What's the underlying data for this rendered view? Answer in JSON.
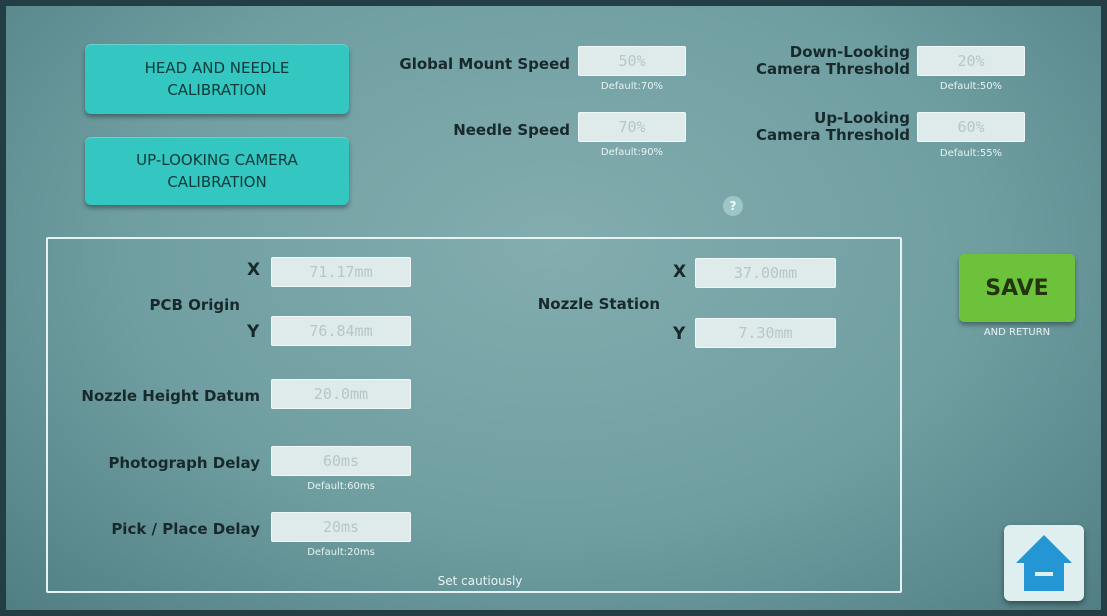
{
  "buttons": {
    "head_needle": "HEAD AND NEEDLE\nCALIBRATION",
    "uplooking_cal": "UP-LOOKING CAMERA\nCALIBRATION",
    "save": "SAVE",
    "save_sub": "AND RETURN",
    "help": "?"
  },
  "top_settings": {
    "global_mount_speed": {
      "label": "Global Mount Speed",
      "value": "50%",
      "default": "Default:70%"
    },
    "needle_speed": {
      "label": "Needle Speed",
      "value": "70%",
      "default": "Default:90%"
    },
    "down_threshold": {
      "label": "Down-Looking\nCamera Threshold",
      "value": "20%",
      "default": "Default:50%"
    },
    "up_threshold": {
      "label": "Up-Looking\nCamera Threshold",
      "value": "60%",
      "default": "Default:55%"
    }
  },
  "panel": {
    "pcb_origin": {
      "label": "PCB Origin",
      "x_axis": "X",
      "y_axis": "Y",
      "x": "71.17mm",
      "y": "76.84mm"
    },
    "nozzle_station": {
      "label": "Nozzle Station",
      "x_axis": "X",
      "y_axis": "Y",
      "x": "37.00mm",
      "y": "7.30mm"
    },
    "nozzle_height": {
      "label": "Nozzle Height Datum",
      "value": "20.0mm"
    },
    "photo_delay": {
      "label": "Photograph Delay",
      "value": "60ms",
      "default": "Default:60ms"
    },
    "pick_delay": {
      "label": "Pick / Place Delay",
      "value": "20ms",
      "default": "Default:20ms"
    },
    "footer": "Set cautiously"
  },
  "icons": {
    "home": "home-icon",
    "help": "question-icon"
  },
  "colors": {
    "teal_button": "#34c6c0",
    "save_green": "#6cc33b",
    "home_blue": "#2596d4"
  }
}
